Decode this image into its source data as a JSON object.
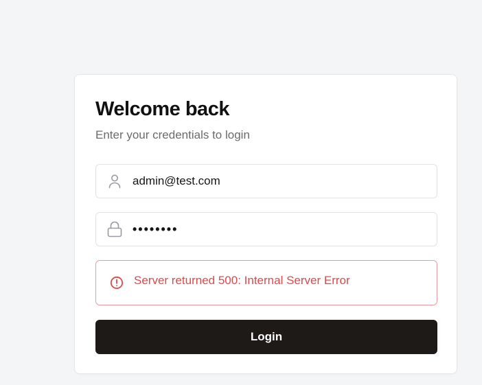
{
  "login": {
    "title": "Welcome back",
    "subtitle": "Enter your credentials to login",
    "email_value": "admin@test.com",
    "password_value": "••••••••",
    "error_message": "Server returned 500: Internal Server Error",
    "submit_label": "Login"
  },
  "icons": {
    "email": "user-icon",
    "password": "lock-icon",
    "error": "alert-circle-icon"
  },
  "colors": {
    "background": "#f4f5f7",
    "card": "#ffffff",
    "error": "#e04848",
    "error_border": "#ef9a9a",
    "button": "#1d1a18",
    "button_text": "#ffffff"
  }
}
